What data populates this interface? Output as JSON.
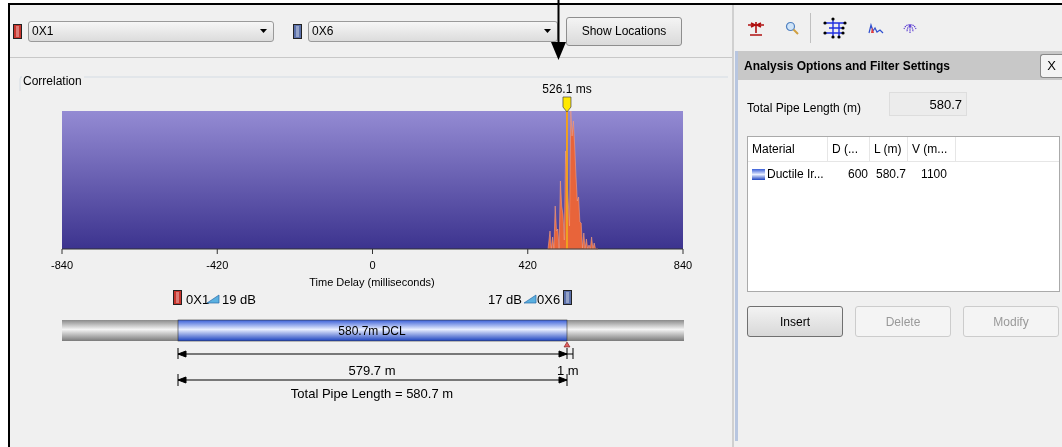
{
  "sensors": [
    {
      "value": "0X1",
      "color": "#c8342c"
    },
    {
      "value": "0X6",
      "color": "#5b70aa"
    }
  ],
  "show_locations_button": "Show Locations",
  "correlation": {
    "title": "Correlation",
    "peak_label": "526.1 ms",
    "xticks": [
      "-840",
      "-420",
      "0",
      "420",
      "840"
    ],
    "xlabel": "Time Delay (milliseconds)",
    "left_sensor": {
      "label": "0X1",
      "gain": "19 dB"
    },
    "right_sensor": {
      "label": "0X6",
      "gain": "17 dB"
    },
    "pipe_label": "580.7m DCL",
    "dimension": "579.7 m",
    "offset": "1 m",
    "total_label": "Total Pipe Length = 580.7 m"
  },
  "panel": {
    "title": "Analysis Options and Filter Settings",
    "close": "X",
    "total_length_label": "Total Pipe Length (m)",
    "total_length_value": "580.7",
    "table": {
      "columns": [
        "Material",
        "D (...",
        "L (m)",
        "V (m..."
      ],
      "rows": [
        {
          "cells": [
            "Ductile Ir...",
            "600",
            "580.7",
            "1100"
          ]
        }
      ]
    },
    "buttons": [
      {
        "label": "Insert",
        "disabled": false
      },
      {
        "label": "Delete",
        "disabled": true
      },
      {
        "label": "Modify",
        "disabled": true
      }
    ]
  }
}
